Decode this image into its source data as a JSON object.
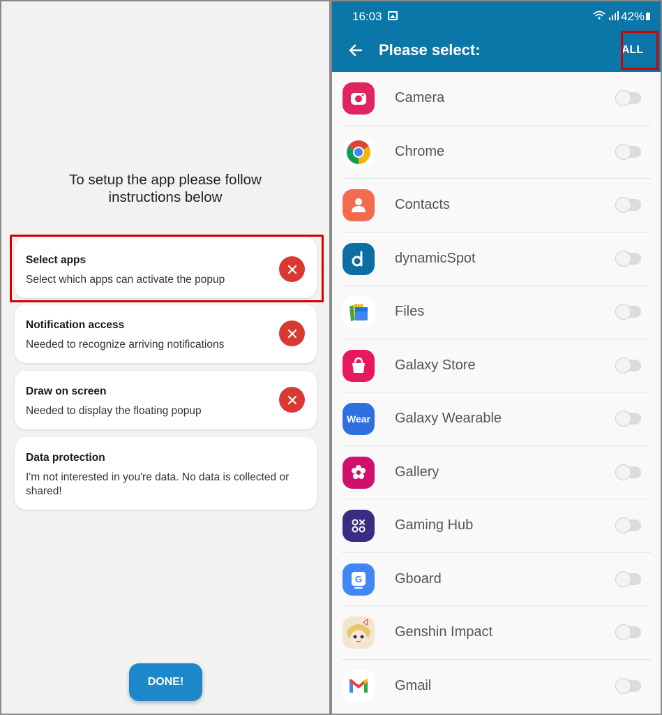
{
  "setup": {
    "intro_line1": "To setup the app please follow",
    "intro_line2": "instructions below",
    "cards": [
      {
        "title": "Select apps",
        "subtitle": "Select which apps can activate the popup"
      },
      {
        "title": "Notification access",
        "subtitle": "Needed to recognize arriving notifications"
      },
      {
        "title": "Draw on screen",
        "subtitle": "Needed to display the floating popup"
      },
      {
        "title": "Data protection",
        "subtitle": "I'm not interested in you're data. No data is collected or shared!"
      }
    ],
    "done_label": "DONE!"
  },
  "status": {
    "time": "16:03",
    "battery": "42%"
  },
  "appbar": {
    "title": "Please select:",
    "all_label": "ALL"
  },
  "apps": [
    {
      "name": "Camera",
      "icon": "camera-icon",
      "enabled": false
    },
    {
      "name": "Chrome",
      "icon": "chrome-icon",
      "enabled": false
    },
    {
      "name": "Contacts",
      "icon": "contacts-icon",
      "enabled": false
    },
    {
      "name": "dynamicSpot",
      "icon": "dynamicspot-icon",
      "enabled": false
    },
    {
      "name": "Files",
      "icon": "files-icon",
      "enabled": false
    },
    {
      "name": "Galaxy Store",
      "icon": "galaxy-store-icon",
      "enabled": false
    },
    {
      "name": "Galaxy Wearable",
      "icon": "galaxy-wearable-icon",
      "icon_text": "Wear",
      "enabled": false
    },
    {
      "name": "Gallery",
      "icon": "gallery-icon",
      "enabled": false
    },
    {
      "name": "Gaming Hub",
      "icon": "gaming-hub-icon",
      "enabled": false
    },
    {
      "name": "Gboard",
      "icon": "gboard-icon",
      "enabled": false
    },
    {
      "name": "Genshin Impact",
      "icon": "genshin-impact-icon",
      "enabled": false
    },
    {
      "name": "Gmail",
      "icon": "gmail-icon",
      "enabled": false
    }
  ],
  "colors": {
    "accent": "#0a77a8",
    "close": "#d93933",
    "done": "#1c87c9",
    "highlight": "#d20000"
  }
}
